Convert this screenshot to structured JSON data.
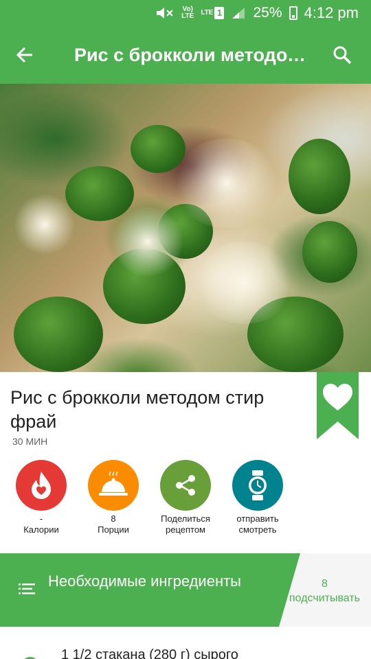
{
  "status_bar": {
    "volte_label": "Vo)\nLTE",
    "network": "LTE",
    "sim": "1",
    "battery": "25%",
    "time": "4:12 pm"
  },
  "app_bar": {
    "title": "Рис с брокколи методом стир фрай"
  },
  "recipe": {
    "title": "Рис с брокколи методом стир фрай",
    "time": "30 МИН"
  },
  "actions": [
    {
      "value": "-",
      "label": "Калории",
      "color": "#e53935",
      "icon": "calories-icon"
    },
    {
      "value": "8",
      "label": "Порции",
      "color": "#fb8c00",
      "icon": "serving-dish-icon"
    },
    {
      "value": "",
      "label": "Поделиться рецептом",
      "color": "#689f38",
      "icon": "share-icon"
    },
    {
      "value": "",
      "label": "отправить смотреть",
      "color": "#00838f",
      "icon": "smartwatch-icon"
    }
  ],
  "ingredients": {
    "title": "Необходимые ингредиенты",
    "count": "8",
    "count_label": "подсчитывать",
    "first_item": "1 1/2 стакана (280 г) сырого"
  },
  "colors": {
    "primary": "#4caf50",
    "favorite_ribbon": "#4caf50"
  }
}
